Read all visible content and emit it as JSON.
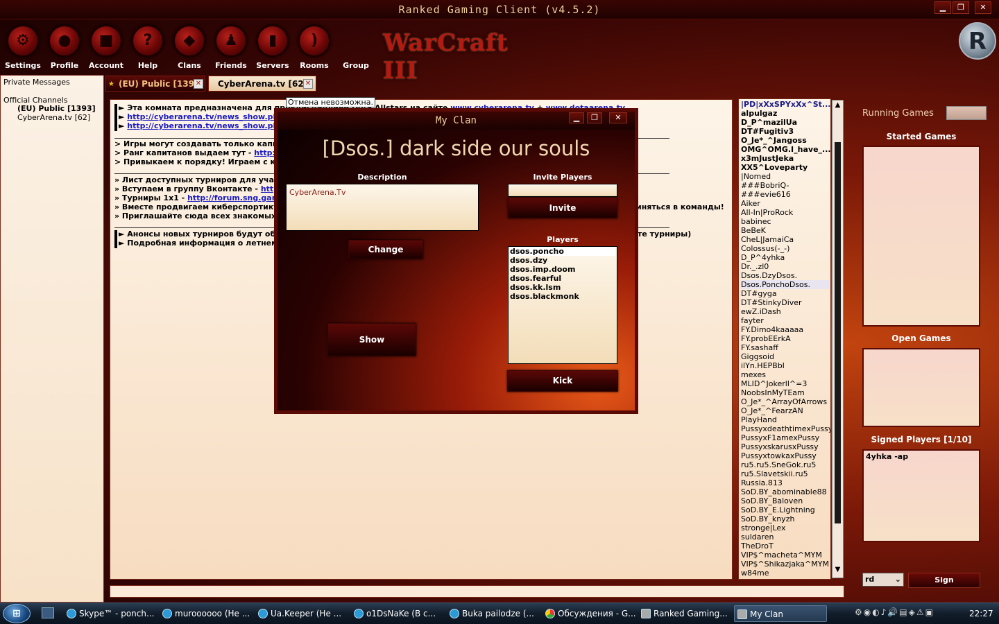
{
  "window": {
    "title": "Ranked Gaming Client (v4.5.2)"
  },
  "toolbar": {
    "items": [
      {
        "label": "Settings",
        "icon": "gear-icon",
        "glyph": "⚙"
      },
      {
        "label": "Profile",
        "icon": "profile-icon",
        "glyph": "●"
      },
      {
        "label": "Account",
        "icon": "lock-icon",
        "glyph": "■"
      },
      {
        "label": "Help",
        "icon": "help-icon",
        "glyph": "?"
      },
      {
        "label": "Clans",
        "icon": "shield-icon",
        "glyph": "◆"
      },
      {
        "label": "Friends",
        "icon": "friends-icon",
        "glyph": "♟"
      },
      {
        "label": "Servers",
        "icon": "servers-icon",
        "glyph": "▮"
      },
      {
        "label": "Rooms",
        "icon": "rss-icon",
        "glyph": ")"
      },
      {
        "label": "Group",
        "icon": "group-icon",
        "glyph": ""
      }
    ],
    "logo_text": "WarCraft III",
    "brand_letter": "R"
  },
  "left_panel": {
    "private_messages": "Private Messages",
    "official_channels": "Official Channels",
    "channels": [
      "(EU) Public [1393]",
      "CyberArena.tv [62]"
    ]
  },
  "tabs": [
    {
      "label": "(EU) Public [1393]",
      "close": "✕"
    },
    {
      "label": "CyberArena.tv [62]",
      "close": "✕"
    }
  ],
  "tooltip": "Отмена невозможна.",
  "chat": {
    "lines": [
      {
        "text": "► Эта комната предназначена для пров",
        "link": "",
        "suffix": "дисциплине Dota Allstars на сайте ",
        "link2": "www.cyberarena.tv",
        "mid": " + ",
        "link3": "www.dotaarena.tv",
        "bar": true
      },
      {
        "text": "► ",
        "link": "http://cyberarena.tv/news_show.php",
        "bar": true
      },
      {
        "text": "► ",
        "link": "http://cyberarena.tv/news_show.php",
        "bar": true
      },
      {
        "text": "> Игры могут создавать только капита",
        "link": ""
      },
      {
        "text": "> Ранг капитанов выдаем тут - ",
        "link": "http://v"
      },
      {
        "text": "> Привыкаем к порядку! Играем с клан",
        "link": ""
      },
      {
        "text": "» Лист доступных турниров для участи",
        "link": ""
      },
      {
        "text": "» Вступаем в группу Вконтакте - ",
        "link": "http:"
      },
      {
        "text": "» Турниры 1x1 - ",
        "link": "http://forum.sng.garena"
      },
      {
        "text": "» Вместе продвигаем киберспортикунк",
        "link": "",
        "tail": "иняться в команды!"
      },
      {
        "text": "» Приглашайте сюда всех знакомых и д",
        "link": ""
      },
      {
        "text": "► Анонсы новых турниров будут обно",
        "link": "",
        "tail": "те турниры)",
        "bar": true
      },
      {
        "text": "► Подробная информация о летнем ас",
        "link": "",
        "bar": true
      }
    ]
  },
  "players": [
    {
      "name": "|PD|xXxSPYxXx^St...",
      "bold": true
    },
    {
      "name": "alpulgaz",
      "bold": true
    },
    {
      "name": "D_P^mazilUa",
      "bold": true
    },
    {
      "name": "DT#Fugitiv3",
      "bold": true
    },
    {
      "name": "O_Je*_^Jangoss",
      "bold": true
    },
    {
      "name": "OMG^OMG.I_have_...",
      "bold": true
    },
    {
      "name": "x3mJustJeka",
      "bold": true
    },
    {
      "name": "XX5^Loveparty",
      "bold": true
    },
    {
      "name": "|Nomed",
      "bold": false
    },
    {
      "name": "###BobriQ-",
      "bold": false
    },
    {
      "name": "###evie616",
      "bold": false
    },
    {
      "name": "Aiker",
      "bold": false
    },
    {
      "name": "All-In|ProRock",
      "bold": false
    },
    {
      "name": "babinec",
      "bold": false
    },
    {
      "name": "BeBeK",
      "bold": false
    },
    {
      "name": "CheL|JamaiCa",
      "bold": false
    },
    {
      "name": "Colossus(-_-)",
      "bold": false
    },
    {
      "name": "D_P^4yhka",
      "bold": false
    },
    {
      "name": "Dr._.zl0",
      "bold": false
    },
    {
      "name": "Dsos.DzyDsos.",
      "bold": false
    },
    {
      "name": "Dsos.PonchoDsos.",
      "bold": false
    },
    {
      "name": "DT#gyga",
      "bold": false
    },
    {
      "name": "DT#StinkyDiver",
      "bold": false
    },
    {
      "name": "ewZ.iDash",
      "bold": false
    },
    {
      "name": "fayter",
      "bold": false
    },
    {
      "name": "FY.Dimo4kaaaaa",
      "bold": false
    },
    {
      "name": "FY.probEErkA",
      "bold": false
    },
    {
      "name": "FY.sashaff",
      "bold": false
    },
    {
      "name": "Giggsoid",
      "bold": false
    },
    {
      "name": "ilYn.HEPBbI",
      "bold": false
    },
    {
      "name": "mexes",
      "bold": false
    },
    {
      "name": "MLID^Jokerll^=3",
      "bold": false
    },
    {
      "name": "NoobsInMyTEam",
      "bold": false
    },
    {
      "name": "O_Je*_^ArrayOfArrows",
      "bold": false
    },
    {
      "name": "O_Je*_^FearzAN",
      "bold": false
    },
    {
      "name": "PlayHand",
      "bold": false
    },
    {
      "name": "PussyxdeathtimexPussy",
      "bold": false
    },
    {
      "name": "PussyxF1amexPussy",
      "bold": false
    },
    {
      "name": "PussyxskarusxPussy",
      "bold": false
    },
    {
      "name": "PussyxtowkaxPussy",
      "bold": false
    },
    {
      "name": "ru5.ru5.SneGok.ru5",
      "bold": false
    },
    {
      "name": "ru5.Slavetskii.ru5",
      "bold": false
    },
    {
      "name": "Russia.813",
      "bold": false
    },
    {
      "name": "SoD.BY_abominable88",
      "bold": false
    },
    {
      "name": "SoD.BY_Baloven",
      "bold": false
    },
    {
      "name": "SoD.BY_E.Lightning",
      "bold": false
    },
    {
      "name": "SoD.BY_knyzh",
      "bold": false
    },
    {
      "name": "stronge|Lex",
      "bold": false
    },
    {
      "name": "suldaren",
      "bold": false
    },
    {
      "name": "TheDroT",
      "bold": false
    },
    {
      "name": "VIP$^macheta^MYM",
      "bold": false
    },
    {
      "name": "VIP$^Shikazjaka^MYM",
      "bold": false
    },
    {
      "name": "w84me",
      "bold": false
    }
  ],
  "right_panel": {
    "running_games": "Running Games",
    "started_games": "Started Games",
    "open_games": "Open Games",
    "signed_players": "Signed Players [1/10]",
    "signed_list": [
      "4yhka -ap"
    ],
    "select_value": "rd",
    "sign_label": "Sign"
  },
  "dialog": {
    "title": "My Clan",
    "clan_name": "[Dsos.] dark side our souls",
    "description_label": "Description",
    "description_value": "CyberArena.Tv",
    "change_label": "Change",
    "show_label": "Show",
    "invite_label": "Invite Players",
    "invite_button": "Invite",
    "players_label": "Players",
    "members": [
      "dsos.poncho",
      "dsos.dzy",
      "dsos.imp.doom",
      "dsos.fearful",
      "dsos.kk.lsm",
      "dsos.blackmonk"
    ],
    "kick_label": "Kick"
  },
  "taskbar": {
    "start": "⊞",
    "tasks": [
      {
        "label": "Skype™ - ponch...",
        "icon": "skype-icon"
      },
      {
        "label": "muroooooo (He ...",
        "icon": "chat-icon"
      },
      {
        "label": "Ua.Keeper (He ...",
        "icon": "chat-icon"
      },
      {
        "label": "o1DsNaKe (B c...",
        "icon": "chat-icon"
      },
      {
        "label": "Buka pailodze (...",
        "icon": "chat-icon"
      },
      {
        "label": "Обсуждения - G...",
        "icon": "chrome-icon"
      },
      {
        "label": "Ranked Gaming...",
        "icon": "app-icon"
      },
      {
        "label": "My Clan",
        "icon": "app-icon"
      }
    ],
    "clock": "22:27"
  }
}
